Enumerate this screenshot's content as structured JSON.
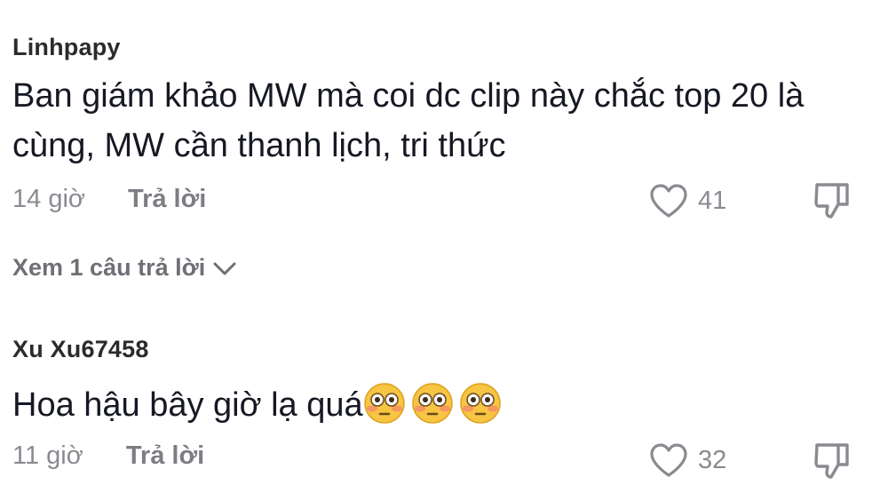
{
  "comments": [
    {
      "username": "Linhpapy",
      "text": "Ban giám khảo MW mà coi dc clip này chắc top 20 là cùng, MW cần thanh lịch, tri thức",
      "time": "14 giờ",
      "reply_label": "Trả lời",
      "likes": "41",
      "like_icon": "heart-outline-icon",
      "dislike_icon": "thumbs-down-icon",
      "view_replies": "Xem 1 câu trả lời"
    },
    {
      "username": "Xu Xu67458",
      "text": "Hoa hậu bây giờ lạ quá",
      "emojis": [
        "flushed-face-emoji",
        "flushed-face-emoji",
        "flushed-face-emoji"
      ],
      "time": "11 giờ",
      "reply_label": "Trả lời",
      "likes": "32",
      "like_icon": "heart-outline-icon",
      "dislike_icon": "thumbs-down-icon"
    }
  ],
  "colors": {
    "text": "#161823",
    "username": "#2b2b2b",
    "muted": "#8a8b91",
    "icon": "#8a8b91"
  }
}
